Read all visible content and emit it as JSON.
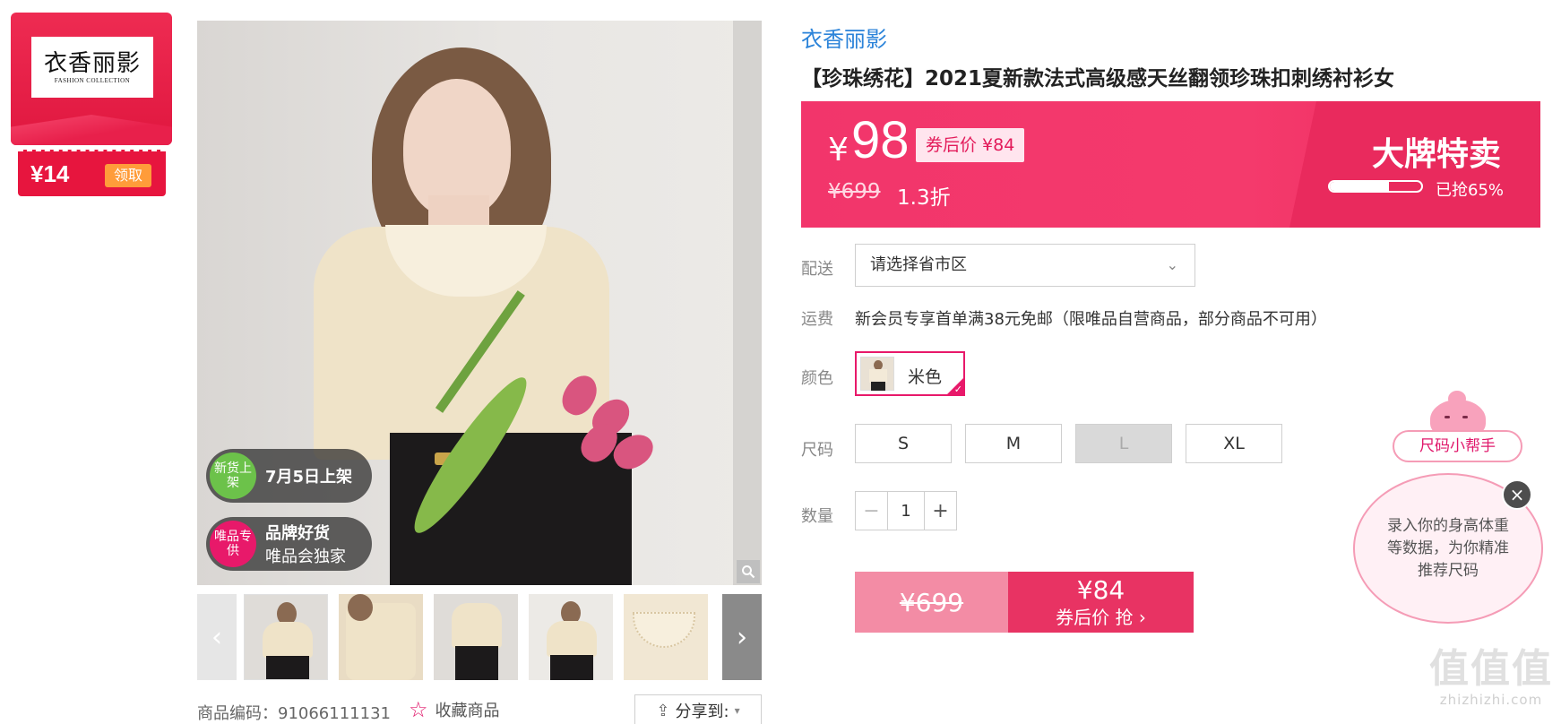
{
  "brand_coupon": {
    "logo_text": "衣香丽影",
    "logo_sub": "FASHION COLLECTION",
    "amount": "¥14",
    "claim_label": "领取"
  },
  "gallery": {
    "badges": [
      {
        "circle": "新货上架",
        "line1": "7月5日上架",
        "line2": ""
      },
      {
        "circle": "唯品专供",
        "line1": "品牌好货",
        "line2": "唯品会独家"
      }
    ],
    "zoom_icon": "magnifier-icon",
    "prev_icon": "chevron-left-icon",
    "next_icon": "chevron-right-icon",
    "thumbnail_count": 6
  },
  "footer": {
    "sku": "商品编码：91066111131",
    "favorite_label": "收藏商品",
    "share_label": "分享到:"
  },
  "product": {
    "brand": "衣香丽影",
    "title": "【珍珠绣花】2021夏新款法式高级感天丝翻领珍珠扣刺绣衬衫女"
  },
  "price": {
    "currency": "¥",
    "current": "98",
    "after_coupon": "券后价 ¥84",
    "original": "¥699",
    "discount": "1.3折",
    "sale_label": "大牌特卖",
    "sold_text": "已抢65%",
    "sold_fraction": 0.65
  },
  "delivery": {
    "label": "配送",
    "placeholder": "请选择省市区"
  },
  "shipping": {
    "label": "运费",
    "text": "新会员专享首单满38元免邮（限唯品自营商品，部分商品不可用）"
  },
  "color": {
    "label": "颜色",
    "option": "米色"
  },
  "size": {
    "label": "尺码",
    "options": [
      "S",
      "M",
      "L",
      "XL"
    ],
    "disabled": [
      "L"
    ]
  },
  "quantity": {
    "label": "数量",
    "value": "1",
    "minus": "−",
    "plus": "+"
  },
  "buy": {
    "original_price": "¥699",
    "coupon_price": "¥84",
    "action": "券后价 抢 ›"
  },
  "size_helper": {
    "tag": "尺码小帮手",
    "bubble": "录入你的身高体重等数据，为你精准推荐尺码",
    "close": "×"
  },
  "watermark": {
    "logo": "值值值",
    "url": "zhizhizhi.com"
  },
  "colors": {
    "accent": "#e8196a",
    "banner": "#f2356b",
    "brand_blue": "#2b83d9",
    "coupon_red": "#e7153e",
    "claim_orange": "#ff9c3a"
  }
}
